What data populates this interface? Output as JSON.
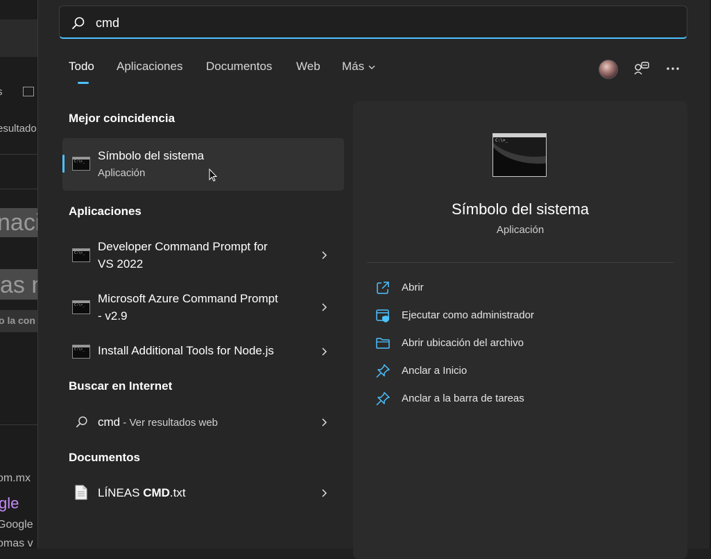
{
  "background_page": {
    "fragments": [
      "s",
      "esultado",
      "naci",
      "as n",
      "o la con",
      "om.mx",
      "gle",
      "Google",
      "omas v"
    ]
  },
  "search": {
    "value": "cmd",
    "placeholder": ""
  },
  "tabs": [
    {
      "label": "Todo",
      "active": true
    },
    {
      "label": "Aplicaciones",
      "active": false
    },
    {
      "label": "Documentos",
      "active": false
    },
    {
      "label": "Web",
      "active": false
    },
    {
      "label": "Más",
      "active": false
    }
  ],
  "top_icons": [
    "avatar",
    "share-icon",
    "more-options-icon"
  ],
  "best_match": {
    "section_title": "Mejor coincidencia",
    "title": "Símbolo del sistema",
    "subtitle": "Aplicación"
  },
  "apps": {
    "section_title": "Aplicaciones",
    "items": [
      {
        "line1": "Developer Command Prompt for",
        "line2": "VS 2022"
      },
      {
        "line1": "Microsoft Azure Command Prompt",
        "line2": "- v2.9"
      },
      {
        "line1": "Install Additional Tools for Node.js",
        "line2": ""
      }
    ]
  },
  "internet": {
    "section_title": "Buscar en Internet",
    "query": "cmd",
    "suffix": " - Ver resultados web"
  },
  "documents": {
    "section_title": "Documentos",
    "items": [
      {
        "prefix": "LÍNEAS ",
        "bold": "CMD",
        "suffix": ".txt"
      }
    ]
  },
  "preview": {
    "title": "Símbolo del sistema",
    "subtitle": "Aplicación",
    "actions": [
      {
        "label": "Abrir",
        "icon": "open-external-icon"
      },
      {
        "label": "Ejecutar como administrador",
        "icon": "shield-admin-icon"
      },
      {
        "label": "Abrir ubicación del archivo",
        "icon": "folder-icon"
      },
      {
        "label": "Anclar a Inicio",
        "icon": "pin-icon"
      },
      {
        "label": "Anclar a la barra de tareas",
        "icon": "pin-icon"
      }
    ]
  },
  "colors": {
    "accent": "#4cc2ff",
    "panel": "#262626",
    "preview_bg": "#2b2b2b"
  }
}
